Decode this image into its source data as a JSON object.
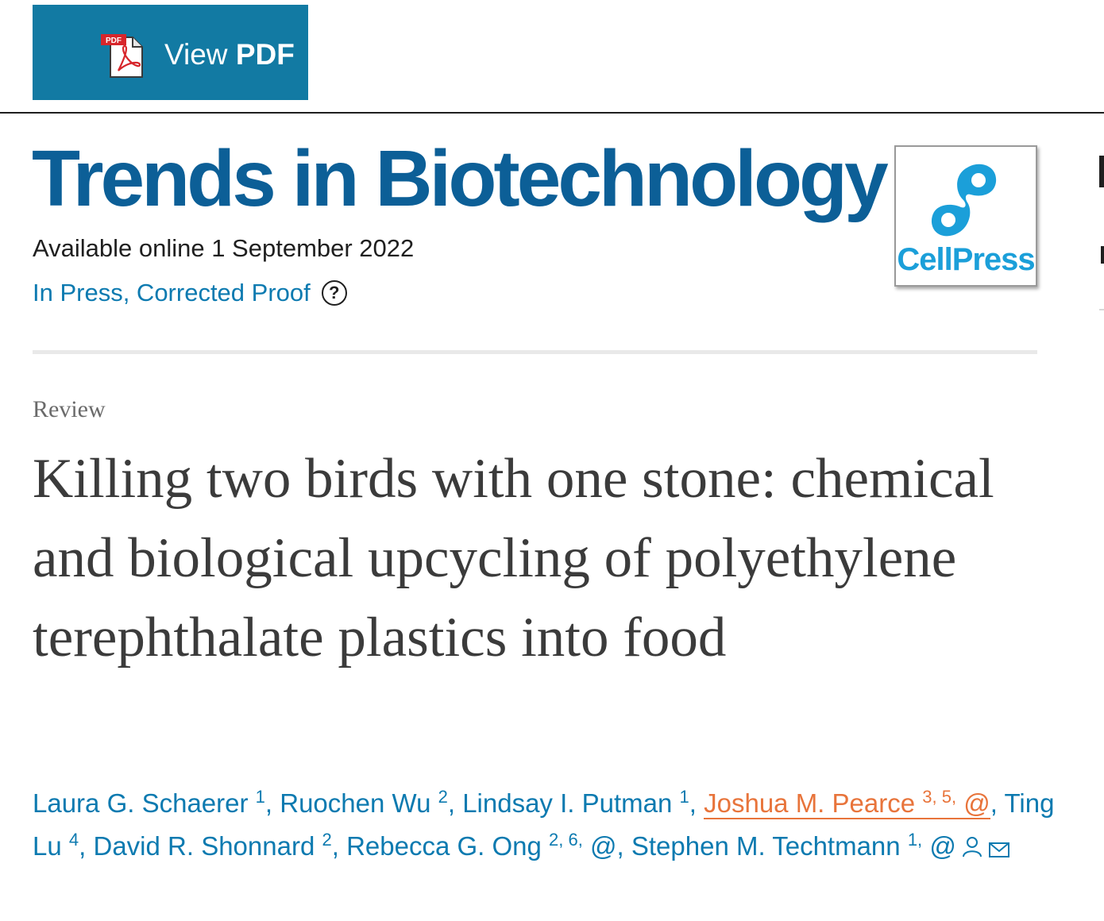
{
  "toolbar": {
    "view_label": "View",
    "pdf_label": "PDF",
    "pdf_icon": "pdf-file-icon",
    "pdf_icon_text": "PDF"
  },
  "journal": {
    "title": "Trends in Biotechnology",
    "cover_text": "CellPress",
    "available": "Available online 1 September 2022",
    "status": "In Press, Corrected Proof",
    "help_icon_text": "?"
  },
  "article": {
    "type": "Review",
    "title": "Killing two birds with one stone: chemical and biological upcycling of polyethylene terephthalate plastics into food"
  },
  "authors": [
    {
      "name": "Laura G. Schaerer",
      "sup": "1",
      "sep": ", "
    },
    {
      "name": "Ruochen Wu",
      "sup": "2",
      "sep": ", "
    },
    {
      "name": "Lindsay I. Putman",
      "sup": "1",
      "sep": ", "
    },
    {
      "name": "Joshua M. Pearce",
      "sup": "3, 5,",
      "email": "@",
      "sep": ", "
    },
    {
      "name": "Ting Lu",
      "sup": "4",
      "sep": ", "
    },
    {
      "name": "David R. Shonnard",
      "sup": "2",
      "sep": ", "
    },
    {
      "name": "Rebecca G. Ong",
      "sup": "2, 6,",
      "email": "@",
      "sep": ", "
    },
    {
      "name": "Stephen M. Techtmann",
      "sup": "1,",
      "email": "@",
      "sep": ""
    }
  ],
  "colors": {
    "pdf_button": "#127aa3",
    "journal_title": "#0c5f97",
    "link": "#0c7ab0",
    "highlight_author": "#e8743b",
    "cellpress": "#1b9fd9"
  },
  "icons": [
    "pdf-file-icon",
    "help-icon",
    "cellpress-logo",
    "person-icon",
    "envelope-icon"
  ]
}
